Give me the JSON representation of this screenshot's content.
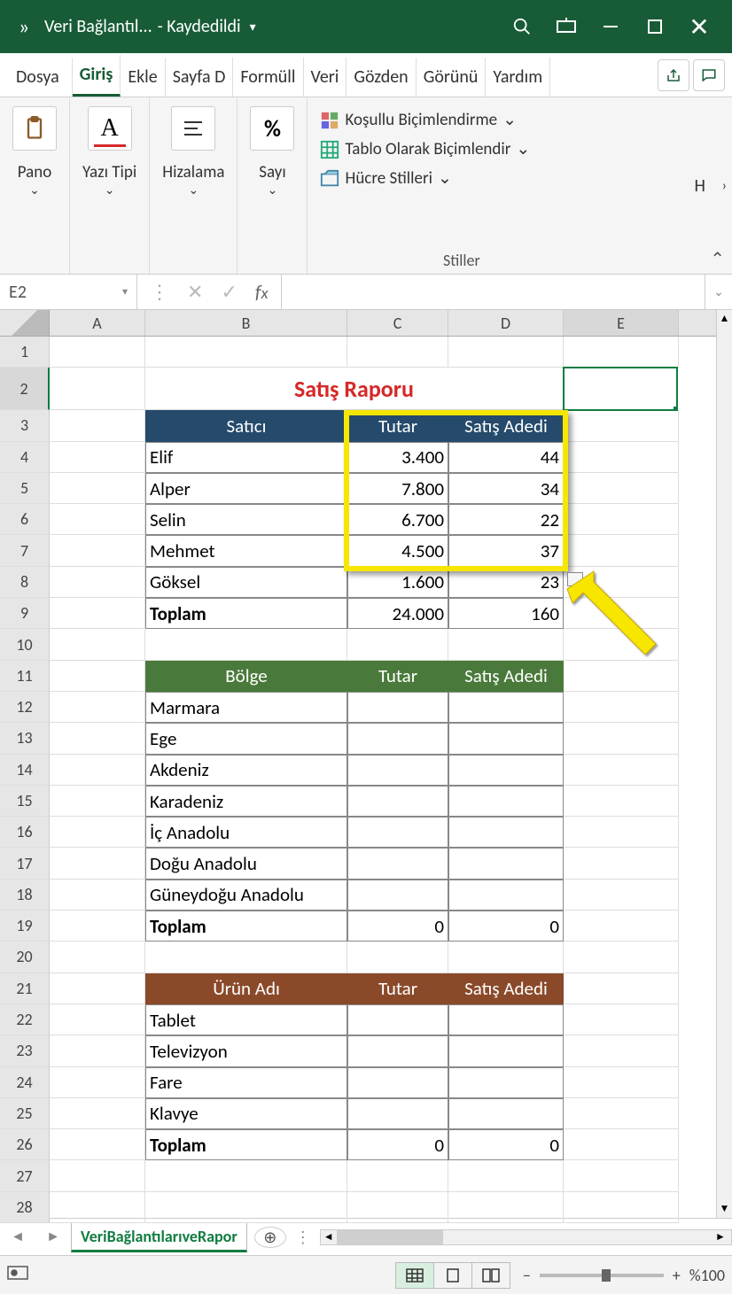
{
  "titlebar": {
    "doc": "Veri Bağlantıl...",
    "saved": "- Kaydedildi"
  },
  "tabs": [
    "Dosya",
    "Giriş",
    "Ekle",
    "Sayfa D",
    "Formüll",
    "Veri",
    "Gözden",
    "Görünü",
    "Yardım"
  ],
  "ribbon": {
    "pano": "Pano",
    "yazi": "Yazı Tipi",
    "hizalama": "Hizalama",
    "sayi": "Sayı",
    "kosullu": "Koşullu Biçimlendirme",
    "tablo": "Tablo Olarak Biçimlendir",
    "hucre": "Hücre Stilleri",
    "stiller": "Stiller",
    "hcell": "H"
  },
  "fx": {
    "name": "E2"
  },
  "columns": [
    "A",
    "B",
    "C",
    "D",
    "E"
  ],
  "report_title": "Satış Raporu",
  "table1": {
    "headers": [
      "Satıcı",
      "Tutar",
      "Satış Adedi"
    ],
    "rows": [
      {
        "n": "Elif",
        "t": "3.400",
        "a": "44"
      },
      {
        "n": "Alper",
        "t": "7.800",
        "a": "34"
      },
      {
        "n": "Selin",
        "t": "6.700",
        "a": "22"
      },
      {
        "n": "Mehmet",
        "t": "4.500",
        "a": "37"
      },
      {
        "n": "Göksel",
        "t": "1.600",
        "a": "23"
      }
    ],
    "total_label": "Toplam",
    "total_t": "24.000",
    "total_a": "160"
  },
  "table2": {
    "headers": [
      "Bölge",
      "Tutar",
      "Satış Adedi"
    ],
    "rows": [
      "Marmara",
      "Ege",
      "Akdeniz",
      "Karadeniz",
      "İç Anadolu",
      "Doğu Anadolu",
      "Güneydoğu Anadolu"
    ],
    "total_label": "Toplam",
    "total_t": "0",
    "total_a": "0"
  },
  "table3": {
    "headers": [
      "Ürün Adı",
      "Tutar",
      "Satış Adedi"
    ],
    "rows": [
      "Tablet",
      "Televizyon",
      "Fare",
      "Klavye"
    ],
    "total_label": "Toplam",
    "total_t": "0",
    "total_a": "0"
  },
  "sheet_tab": "VeriBağlantılarıveRapor",
  "zoom": "%100"
}
